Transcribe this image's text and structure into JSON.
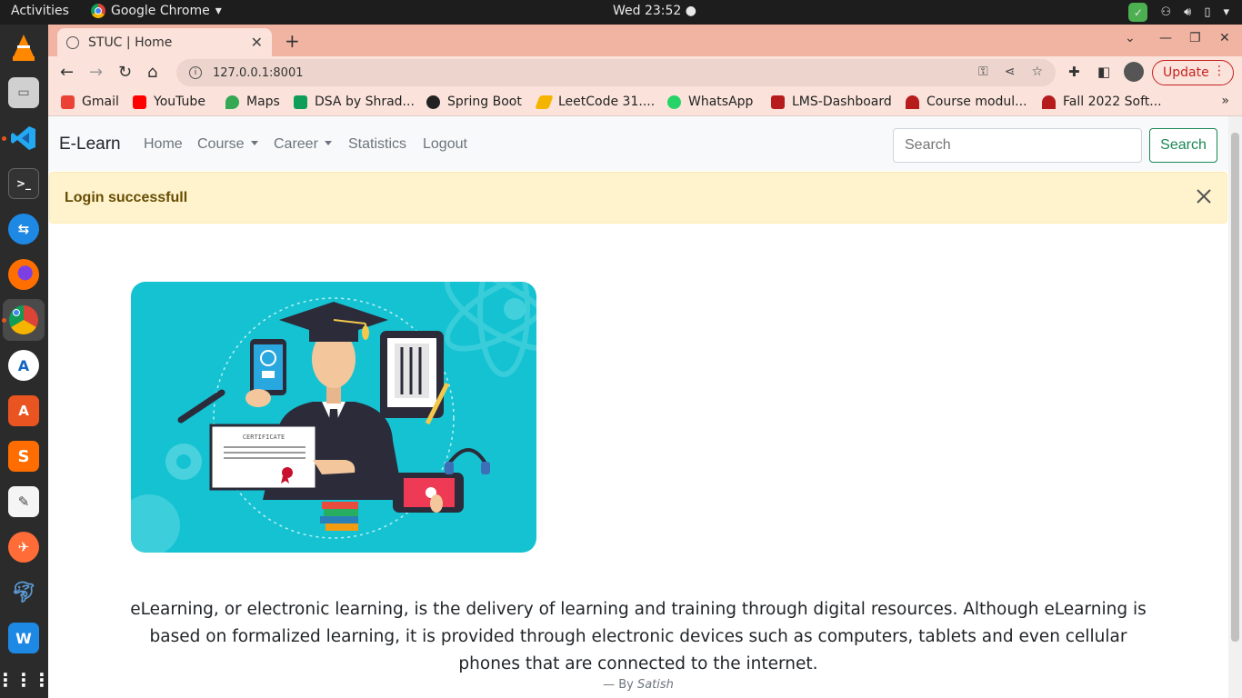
{
  "os": {
    "activities": "Activities",
    "app_menu": "Google Chrome",
    "clock": "Wed 23:52"
  },
  "browser": {
    "tab_title": "STUC | Home",
    "url": "127.0.0.1:8001",
    "update_label": "Update",
    "bookmarks": [
      {
        "label": "Gmail",
        "color": "#ea4335"
      },
      {
        "label": "YouTube",
        "color": "#ff0000"
      },
      {
        "label": "Maps",
        "color": "#34a853"
      },
      {
        "label": "DSA by Shrad...",
        "color": "#0f9d58"
      },
      {
        "label": "Spring Boot",
        "color": "#222222"
      },
      {
        "label": "LeetCode 31....",
        "color": "#f4b400"
      },
      {
        "label": "WhatsApp",
        "color": "#25d366"
      },
      {
        "label": "LMS-Dashboard",
        "color": "#b71c1c"
      },
      {
        "label": "Course modul...",
        "color": "#b71c1c"
      },
      {
        "label": "Fall 2022 Soft...",
        "color": "#b71c1c"
      }
    ]
  },
  "navbar": {
    "brand": "E-Learn",
    "links": [
      "Home",
      "Course",
      "Career",
      "Statistics",
      "Logout"
    ],
    "search_placeholder": "Search",
    "search_button": "Search"
  },
  "alert": {
    "message": "Login successfull"
  },
  "hero": {
    "certificate_text": "CERTIFICATE"
  },
  "quote": {
    "text": "eLearning, or electronic learning, is the delivery of learning and training through digital resources. Although eLearning is based on formalized learning, it is provided through electronic devices such as computers, tablets and even cellular phones that are connected to the internet.",
    "by_prefix": "— By",
    "author": "Satish"
  },
  "colors": {
    "tab_strip": "#f2b4a2",
    "toolbar": "#fbe3db",
    "navbar_bg": "#f8f9fa",
    "alert_bg": "#fff3cd",
    "alert_text": "#664d03",
    "success": "#198754",
    "hero_bg": "#14c2d2"
  }
}
